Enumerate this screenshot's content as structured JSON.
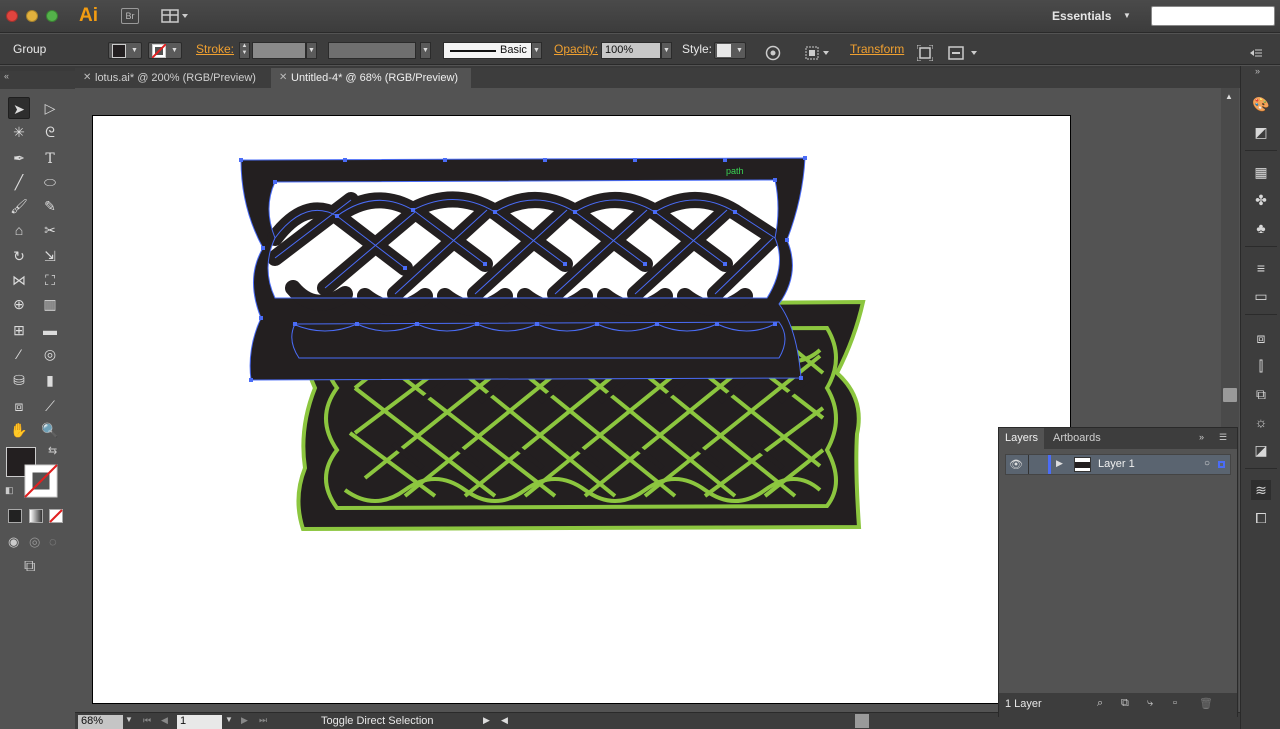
{
  "app": {
    "logo": "Ai",
    "bridge_label": "Br",
    "workspace": "Essentials",
    "search_placeholder": ""
  },
  "control_bar": {
    "selection_type": "Group",
    "stroke_label": "Stroke:",
    "brush_label": "Basic",
    "opacity_label": "Opacity:",
    "opacity_value": "100%",
    "style_label": "Style:",
    "transform_label": "Transform"
  },
  "tabs": [
    {
      "label": "lotus.ai* @ 200% (RGB/Preview)",
      "active": false
    },
    {
      "label": "Untitled-4* @ 68% (RGB/Preview)",
      "active": true
    }
  ],
  "canvas": {
    "hover_label": "path",
    "colors": {
      "knot_fill": "#231f20",
      "outline_green": "#8cc63f",
      "selection": "#4a6cf7"
    }
  },
  "status_bar": {
    "zoom": "68%",
    "page": "1",
    "status_text": "Toggle Direct Selection"
  },
  "layers_panel": {
    "tab_layers": "Layers",
    "tab_artboards": "Artboards",
    "layers": [
      {
        "name": "Layer 1"
      }
    ],
    "count_label": "1 Layer"
  }
}
